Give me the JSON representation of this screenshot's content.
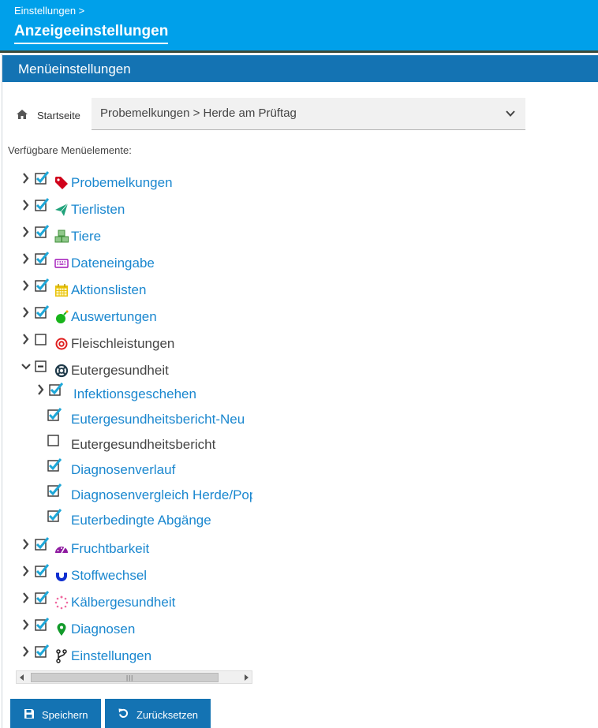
{
  "header": {
    "breadcrumb": "Einstellungen >",
    "title": "Anzeigeeinstellungen"
  },
  "panel": {
    "title": "Menüeinstellungen"
  },
  "startpage": {
    "label": "Startseite",
    "selected": "Probemelkungen > Herde am Prüftag"
  },
  "available_label": "Verfügbare Menüelemente:",
  "menu_items": [
    {
      "label": "Probemelkungen",
      "checked": true,
      "expanded": false,
      "icon": "tag-icon"
    },
    {
      "label": "Tierlisten",
      "checked": true,
      "expanded": false,
      "icon": "paper-plane-icon"
    },
    {
      "label": "Tiere",
      "checked": true,
      "expanded": false,
      "icon": "cubes-icon"
    },
    {
      "label": "Dateneingabe",
      "checked": true,
      "expanded": false,
      "icon": "keyboard-icon"
    },
    {
      "label": "Aktionslisten",
      "checked": true,
      "expanded": false,
      "icon": "calendar-icon"
    },
    {
      "label": "Auswertungen",
      "checked": true,
      "expanded": false,
      "icon": "bomb-icon"
    },
    {
      "label": "Fleischleistungen",
      "checked": false,
      "expanded": false,
      "icon": "target-icon"
    },
    {
      "label": "Eutergesundheit",
      "checked": "partial",
      "expanded": true,
      "icon": "lifebuoy-icon"
    },
    {
      "label": "Fruchtbarkeit",
      "checked": true,
      "expanded": false,
      "icon": "dashboard-icon"
    },
    {
      "label": "Stoffwechsel",
      "checked": true,
      "expanded": false,
      "icon": "magnet-icon"
    },
    {
      "label": "Kälbergesundheit",
      "checked": true,
      "expanded": false,
      "icon": "spinner-icon"
    },
    {
      "label": "Diagnosen",
      "checked": true,
      "expanded": false,
      "icon": "map-marker-icon"
    },
    {
      "label": "Einstellungen",
      "checked": true,
      "expanded": false,
      "icon": "code-fork-icon"
    }
  ],
  "eutergesundheit_children": [
    {
      "label": "Infektionsgeschehen",
      "checked": true,
      "has_children": true
    },
    {
      "label": "Eutergesundheitsbericht-Neu",
      "checked": true
    },
    {
      "label": "Eutergesundheitsbericht",
      "checked": false
    },
    {
      "label": "Diagnosenverlauf",
      "checked": true
    },
    {
      "label": "Diagnosenvergleich Herde/Popul",
      "checked": true
    },
    {
      "label": "Euterbedingte Abgänge",
      "checked": true
    }
  ],
  "buttons": {
    "save": "Speichern",
    "reset": "Zurücksetzen"
  },
  "colors": {
    "header": "#00a0ea",
    "panel_head": "#1473b3",
    "link": "#1a87cf",
    "check": "#1ea7d8"
  }
}
